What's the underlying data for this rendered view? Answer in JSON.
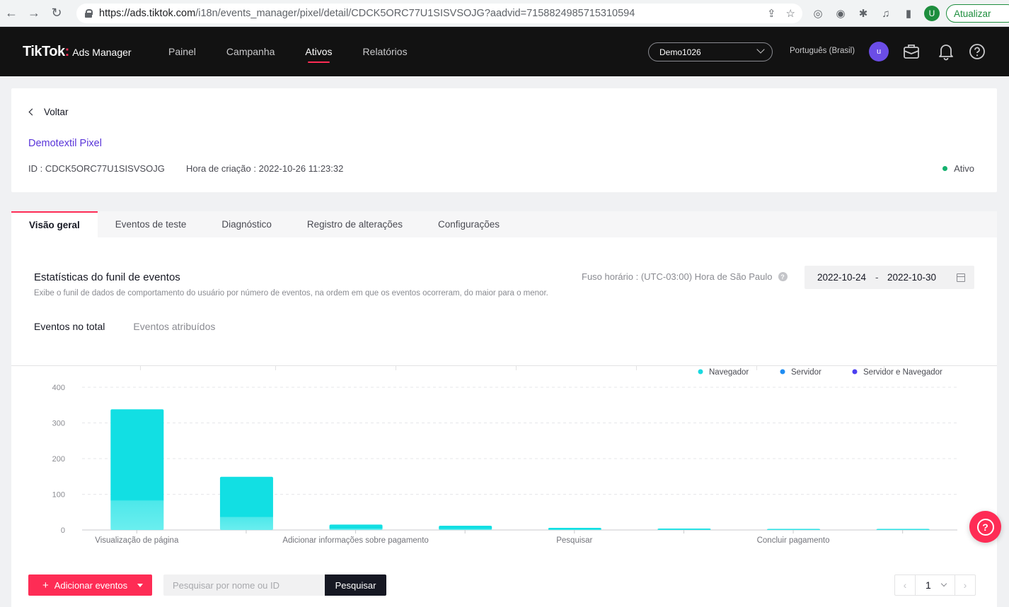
{
  "browser": {
    "url_host": "https://ads.tiktok.com",
    "url_path": "/i18n/events_manager/pixel/detail/CDCK5ORC77U1SISVSOJG?aadvid=7158824985715310594",
    "profile_initial": "U",
    "update_label": "Atualizar"
  },
  "header": {
    "brand": "TikTok",
    "product": "Ads Manager",
    "nav": [
      {
        "label": "Painel",
        "active": false
      },
      {
        "label": "Campanha",
        "active": false
      },
      {
        "label": "Ativos",
        "active": true
      },
      {
        "label": "Relatórios",
        "active": false
      }
    ],
    "account": "Demo1026",
    "language": "Português (Brasil)",
    "user_initial": "u"
  },
  "pixel": {
    "back_label": "Voltar",
    "name": "Demotextil Pixel",
    "id_text": "ID : CDCK5ORC77U1SISVSOJG",
    "created_text": "Hora de criação : 2022-10-26 11:23:32",
    "status": "Ativo",
    "status_color": "#14b16e"
  },
  "tabs": [
    {
      "label": "Visão geral",
      "active": true
    },
    {
      "label": "Eventos de teste",
      "active": false
    },
    {
      "label": "Diagnóstico",
      "active": false
    },
    {
      "label": "Registro de alterações",
      "active": false
    },
    {
      "label": "Configurações",
      "active": false
    }
  ],
  "funnel": {
    "title": "Estatísticas do funil de eventos",
    "description": "Exibe o funil de dados de comportamento do usuário por número de eventos, na ordem em que os eventos ocorreram, do maior para o menor.",
    "timezone": "Fuso horário : (UTC-03:00) Hora de São Paulo",
    "date_start": "2022-10-24",
    "date_sep": "-",
    "date_end": "2022-10-30",
    "subtabs": [
      {
        "label": "Eventos no total",
        "active": true
      },
      {
        "label": "Eventos atribuídos",
        "active": false
      }
    ]
  },
  "chart_data": {
    "type": "bar",
    "categories": [
      "Visualização de página",
      "",
      "Adicionar informações sobre pagamento",
      "",
      "Pesquisar",
      "",
      "Concluir pagamento",
      ""
    ],
    "series": [
      {
        "name": "Navegador",
        "color": "#1ad9e0",
        "values": [
          338,
          149,
          15,
          12,
          6,
          4,
          3,
          1
        ]
      },
      {
        "name": "Servidor",
        "color": "#1f8cf2",
        "values": [
          0,
          0,
          0,
          0,
          0,
          0,
          0,
          0
        ]
      },
      {
        "name": "Servidor e Navegador",
        "color": "#4c3ff0",
        "values": [
          0,
          0,
          0,
          0,
          0,
          0,
          0,
          0
        ]
      }
    ],
    "ylim": [
      0,
      400
    ],
    "yticks": [
      0,
      100,
      200,
      300,
      400
    ],
    "grid": true,
    "legend_position": "top-right"
  },
  "actions": {
    "add_events_label": "Adicionar eventos",
    "search_placeholder": "Pesquisar por nome ou ID",
    "search_label": "Pesquisar",
    "page": "1"
  }
}
